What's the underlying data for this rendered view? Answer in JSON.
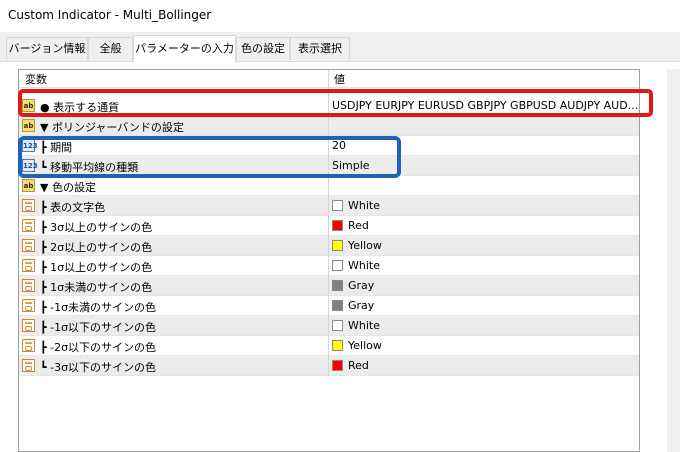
{
  "window": {
    "title": "Custom Indicator - Multi_Bollinger"
  },
  "tabs": [
    {
      "label": "バージョン情報"
    },
    {
      "label": "全般"
    },
    {
      "label": "パラメーターの入力",
      "active": true
    },
    {
      "label": "色の設定"
    },
    {
      "label": "表示選択"
    }
  ],
  "grid": {
    "headers": {
      "variable": "変数",
      "value": "値"
    },
    "rows": [
      {
        "icon": "ab-icon",
        "name": "● 表示する通貨",
        "value": "USDJPY EURJPY EURUSD GBPJPY GBPUSD AUDJPY AUD..."
      },
      {
        "icon": "ab-icon",
        "name": "▼ ボリンジャーバンドの設定",
        "value": ""
      },
      {
        "icon": "numeric-icon",
        "name": "┣ 期間",
        "value": "20"
      },
      {
        "icon": "numeric-icon",
        "name": "┗ 移動平均線の種類",
        "value": "Simple"
      },
      {
        "icon": "ab-icon",
        "name": "▼ 色の設定",
        "value": ""
      },
      {
        "icon": "color-icon",
        "name": "┣ 表の文字色",
        "value": "White",
        "swatch": "#ffffff"
      },
      {
        "icon": "color-icon",
        "name": "┣ 3σ以上のサインの色",
        "value": "Red",
        "swatch": "#ff0000"
      },
      {
        "icon": "color-icon",
        "name": "┣ 2σ以上のサインの色",
        "value": "Yellow",
        "swatch": "#ffff00"
      },
      {
        "icon": "color-icon",
        "name": "┣ 1σ以上のサインの色",
        "value": "White",
        "swatch": "#ffffff"
      },
      {
        "icon": "color-icon",
        "name": "┣ 1σ未満のサインの色",
        "value": "Gray",
        "swatch": "#808080"
      },
      {
        "icon": "color-icon",
        "name": "┣ -1σ未満のサインの色",
        "value": "Gray",
        "swatch": "#808080"
      },
      {
        "icon": "color-icon",
        "name": "┣ -1σ以下のサインの色",
        "value": "White",
        "swatch": "#ffffff"
      },
      {
        "icon": "color-icon",
        "name": "┣ -2σ以下のサインの色",
        "value": "Yellow",
        "swatch": "#ffff00"
      },
      {
        "icon": "color-icon",
        "name": "┗ -3σ以下のサインの色",
        "value": "Red",
        "swatch": "#ff0000"
      }
    ]
  },
  "annotations": {
    "red_box_color": "#e01818",
    "blue_box_color": "#1e63b8"
  }
}
